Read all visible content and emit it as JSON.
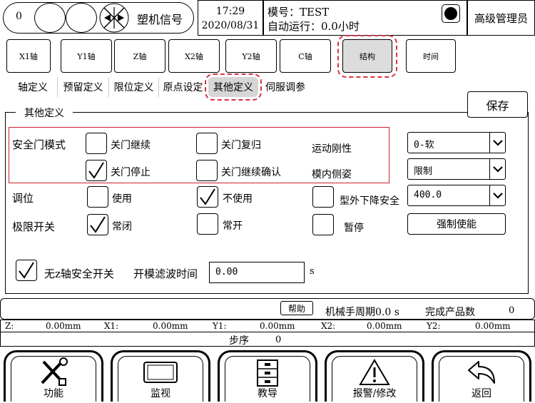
{
  "header": {
    "counter": "0",
    "brand": "塑机信号",
    "time": "17:29",
    "date": "2020/08/31",
    "mold_label": "模号：TEST",
    "auto_run_label": "自动运行：0.0小时",
    "user": "高级管理员"
  },
  "axis_tabs": [
    "X1轴",
    "Y1轴",
    "Z轴",
    "X2轴",
    "Y2轴",
    "C轴",
    "结构",
    "时间"
  ],
  "sub_tabs": [
    "轴定义",
    "预留定义",
    "限位定义",
    "原点设定",
    "其他定义",
    "伺服调参"
  ],
  "panel": {
    "title": "其他定义",
    "save": "保存",
    "safety_door": {
      "label": "安全门模式",
      "opt_close_continue": "关门继续",
      "opt_close_reset": "关门复归",
      "opt_close_stop": "关门停止",
      "opt_close_continue_confirm": "关门继续确认"
    },
    "motion_rigidity": {
      "label": "运动刚性",
      "value": "0-软"
    },
    "in_mold_lateral": {
      "label": "模内侧姿",
      "value": "限制"
    },
    "adjust": {
      "label": "调位",
      "use": "使用",
      "not_use": "不使用"
    },
    "outside_descent": {
      "label": "型外下降安全",
      "value": "400.0"
    },
    "limit_switch": {
      "label": "极限开关",
      "nc": "常闭",
      "no": "常开",
      "pause": "暂停"
    },
    "force_enable": "强制使能",
    "no_z_safety": "无z轴安全开关",
    "mold_filter": {
      "label": "开模滤波时间",
      "value": "0.00",
      "unit": "s"
    }
  },
  "status": {
    "help": "帮助",
    "cycle_label": "机械手周期0.0 s",
    "products_label": "完成产品数",
    "products_value": "0",
    "positions": [
      {
        "axis": "Z:",
        "value": "0.00mm"
      },
      {
        "axis": "X1:",
        "value": "0.00mm"
      },
      {
        "axis": "Y1:",
        "value": "0.00mm"
      },
      {
        "axis": "X2:",
        "value": "0.00mm"
      },
      {
        "axis": "Y2:",
        "value": "0.00mm"
      }
    ],
    "step_label": "步序",
    "step_value": "0"
  },
  "footer": [
    "功能",
    "监视",
    "教导",
    "报警/修改",
    "返回"
  ]
}
